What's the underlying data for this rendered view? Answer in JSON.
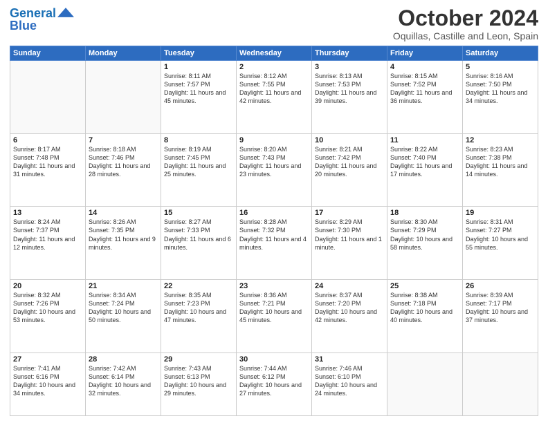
{
  "header": {
    "logo_line1": "General",
    "logo_line2": "Blue",
    "month": "October 2024",
    "location": "Oquillas, Castille and Leon, Spain"
  },
  "days_of_week": [
    "Sunday",
    "Monday",
    "Tuesday",
    "Wednesday",
    "Thursday",
    "Friday",
    "Saturday"
  ],
  "weeks": [
    [
      {
        "day": "",
        "info": ""
      },
      {
        "day": "",
        "info": ""
      },
      {
        "day": "1",
        "info": "Sunrise: 8:11 AM\nSunset: 7:57 PM\nDaylight: 11 hours and 45 minutes."
      },
      {
        "day": "2",
        "info": "Sunrise: 8:12 AM\nSunset: 7:55 PM\nDaylight: 11 hours and 42 minutes."
      },
      {
        "day": "3",
        "info": "Sunrise: 8:13 AM\nSunset: 7:53 PM\nDaylight: 11 hours and 39 minutes."
      },
      {
        "day": "4",
        "info": "Sunrise: 8:15 AM\nSunset: 7:52 PM\nDaylight: 11 hours and 36 minutes."
      },
      {
        "day": "5",
        "info": "Sunrise: 8:16 AM\nSunset: 7:50 PM\nDaylight: 11 hours and 34 minutes."
      }
    ],
    [
      {
        "day": "6",
        "info": "Sunrise: 8:17 AM\nSunset: 7:48 PM\nDaylight: 11 hours and 31 minutes."
      },
      {
        "day": "7",
        "info": "Sunrise: 8:18 AM\nSunset: 7:46 PM\nDaylight: 11 hours and 28 minutes."
      },
      {
        "day": "8",
        "info": "Sunrise: 8:19 AM\nSunset: 7:45 PM\nDaylight: 11 hours and 25 minutes."
      },
      {
        "day": "9",
        "info": "Sunrise: 8:20 AM\nSunset: 7:43 PM\nDaylight: 11 hours and 23 minutes."
      },
      {
        "day": "10",
        "info": "Sunrise: 8:21 AM\nSunset: 7:42 PM\nDaylight: 11 hours and 20 minutes."
      },
      {
        "day": "11",
        "info": "Sunrise: 8:22 AM\nSunset: 7:40 PM\nDaylight: 11 hours and 17 minutes."
      },
      {
        "day": "12",
        "info": "Sunrise: 8:23 AM\nSunset: 7:38 PM\nDaylight: 11 hours and 14 minutes."
      }
    ],
    [
      {
        "day": "13",
        "info": "Sunrise: 8:24 AM\nSunset: 7:37 PM\nDaylight: 11 hours and 12 minutes."
      },
      {
        "day": "14",
        "info": "Sunrise: 8:26 AM\nSunset: 7:35 PM\nDaylight: 11 hours and 9 minutes."
      },
      {
        "day": "15",
        "info": "Sunrise: 8:27 AM\nSunset: 7:33 PM\nDaylight: 11 hours and 6 minutes."
      },
      {
        "day": "16",
        "info": "Sunrise: 8:28 AM\nSunset: 7:32 PM\nDaylight: 11 hours and 4 minutes."
      },
      {
        "day": "17",
        "info": "Sunrise: 8:29 AM\nSunset: 7:30 PM\nDaylight: 11 hours and 1 minute."
      },
      {
        "day": "18",
        "info": "Sunrise: 8:30 AM\nSunset: 7:29 PM\nDaylight: 10 hours and 58 minutes."
      },
      {
        "day": "19",
        "info": "Sunrise: 8:31 AM\nSunset: 7:27 PM\nDaylight: 10 hours and 55 minutes."
      }
    ],
    [
      {
        "day": "20",
        "info": "Sunrise: 8:32 AM\nSunset: 7:26 PM\nDaylight: 10 hours and 53 minutes."
      },
      {
        "day": "21",
        "info": "Sunrise: 8:34 AM\nSunset: 7:24 PM\nDaylight: 10 hours and 50 minutes."
      },
      {
        "day": "22",
        "info": "Sunrise: 8:35 AM\nSunset: 7:23 PM\nDaylight: 10 hours and 47 minutes."
      },
      {
        "day": "23",
        "info": "Sunrise: 8:36 AM\nSunset: 7:21 PM\nDaylight: 10 hours and 45 minutes."
      },
      {
        "day": "24",
        "info": "Sunrise: 8:37 AM\nSunset: 7:20 PM\nDaylight: 10 hours and 42 minutes."
      },
      {
        "day": "25",
        "info": "Sunrise: 8:38 AM\nSunset: 7:18 PM\nDaylight: 10 hours and 40 minutes."
      },
      {
        "day": "26",
        "info": "Sunrise: 8:39 AM\nSunset: 7:17 PM\nDaylight: 10 hours and 37 minutes."
      }
    ],
    [
      {
        "day": "27",
        "info": "Sunrise: 7:41 AM\nSunset: 6:16 PM\nDaylight: 10 hours and 34 minutes."
      },
      {
        "day": "28",
        "info": "Sunrise: 7:42 AM\nSunset: 6:14 PM\nDaylight: 10 hours and 32 minutes."
      },
      {
        "day": "29",
        "info": "Sunrise: 7:43 AM\nSunset: 6:13 PM\nDaylight: 10 hours and 29 minutes."
      },
      {
        "day": "30",
        "info": "Sunrise: 7:44 AM\nSunset: 6:12 PM\nDaylight: 10 hours and 27 minutes."
      },
      {
        "day": "31",
        "info": "Sunrise: 7:46 AM\nSunset: 6:10 PM\nDaylight: 10 hours and 24 minutes."
      },
      {
        "day": "",
        "info": ""
      },
      {
        "day": "",
        "info": ""
      }
    ]
  ]
}
